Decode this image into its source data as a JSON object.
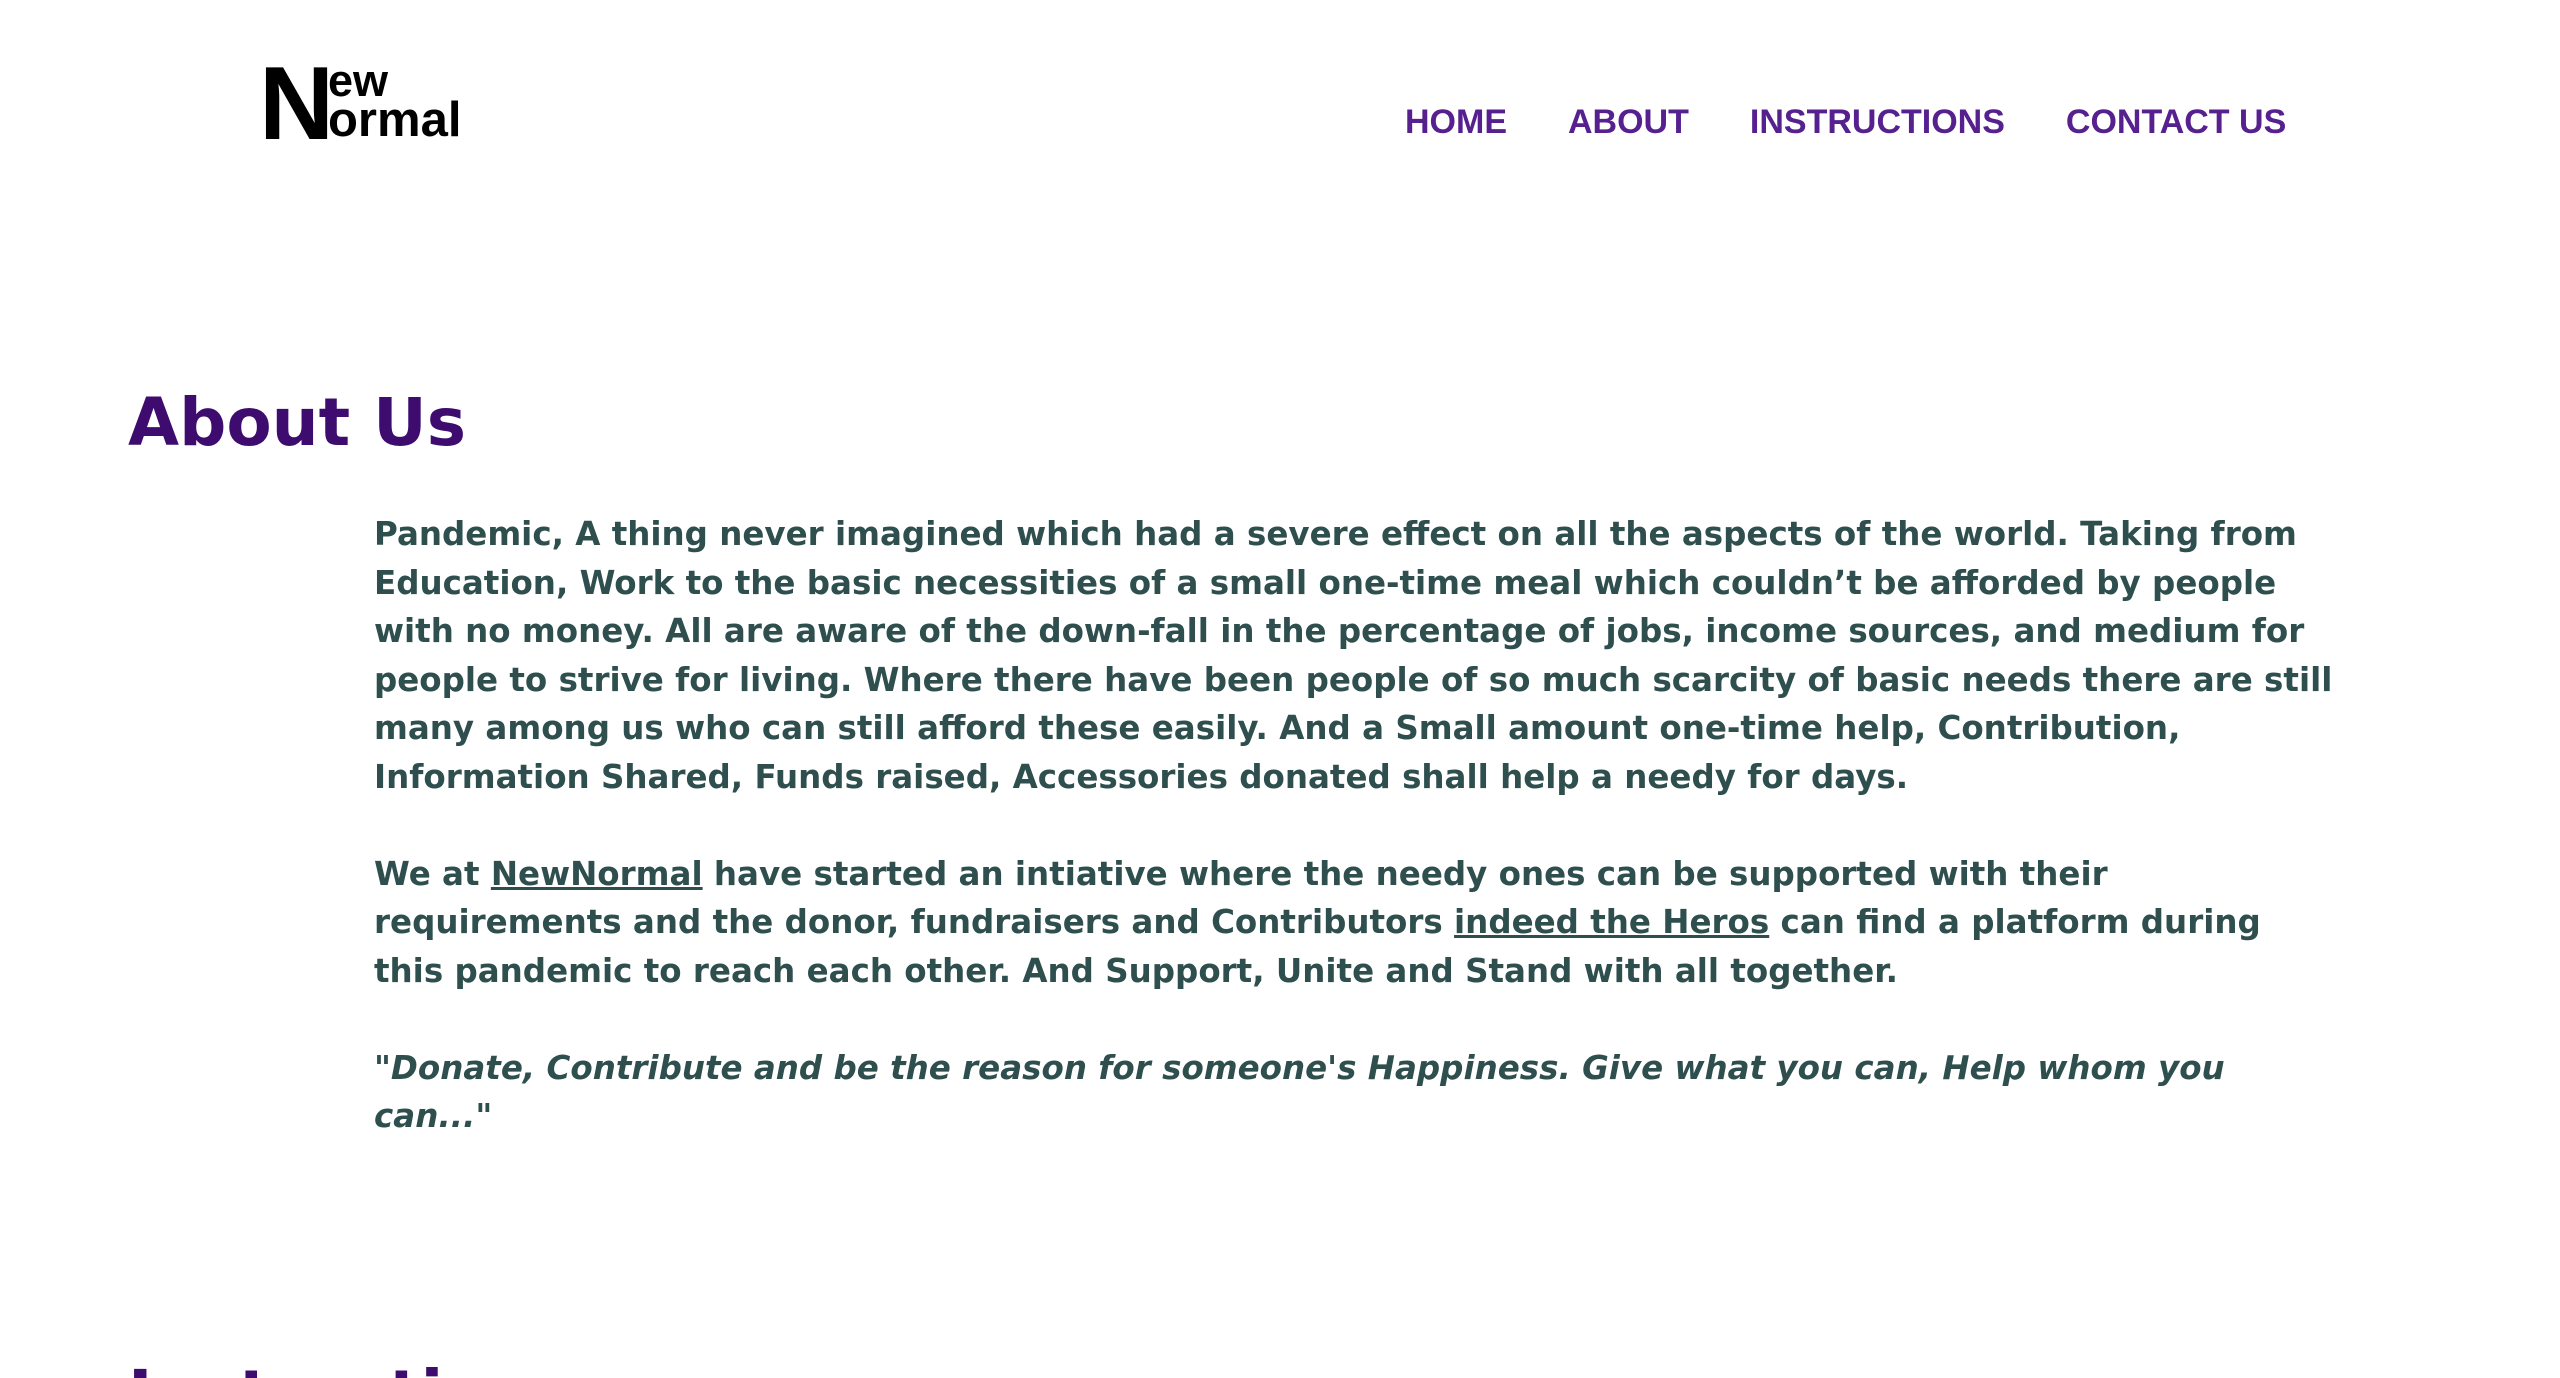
{
  "logo": {
    "initial": "N",
    "top_text": "ew",
    "bottom_text": "ormal"
  },
  "nav": {
    "items": [
      {
        "label": "HOME"
      },
      {
        "label": "ABOUT"
      },
      {
        "label": "INSTRUCTIONS"
      },
      {
        "label": "CONTACT US"
      }
    ]
  },
  "about": {
    "title": "About Us",
    "paragraph1": "Pandemic, A thing never imagined which had a severe effect on all the aspects of the world. Taking from Education, Work to the basic necessities of a small one-time meal which couldn’t be afforded by people with no money. All are aware of the down-fall in the percentage of jobs, income sources, and medium for people to strive for living. Where there have been people of so much scarcity of basic needs there are still many among us who can still afford these easily. And a Small amount one-time help, Contribution, Information Shared, Funds raised, Accessories donated shall help a needy for days.",
    "paragraph2": {
      "before_link1": "We at ",
      "link1": "NewNormal",
      "between_links": " have started an intiative where the needy ones can be supported with their requirements and the donor, fundraisers and Contributors ",
      "link2": "indeed the Heros",
      "after_link2": " can find a platform during this pandemic to reach each other. And Support, Unite and Stand with all together."
    },
    "quote": "\"Donate, Contribute and be the reason for someone's Happiness. Give what you can, Help whom you can...\""
  },
  "next_section": {
    "title": "Instructions"
  },
  "colors": {
    "nav_link": "#56208f",
    "heading": "#3e0c6e",
    "body_text": "#2f4f4f",
    "background": "#ffffff"
  }
}
